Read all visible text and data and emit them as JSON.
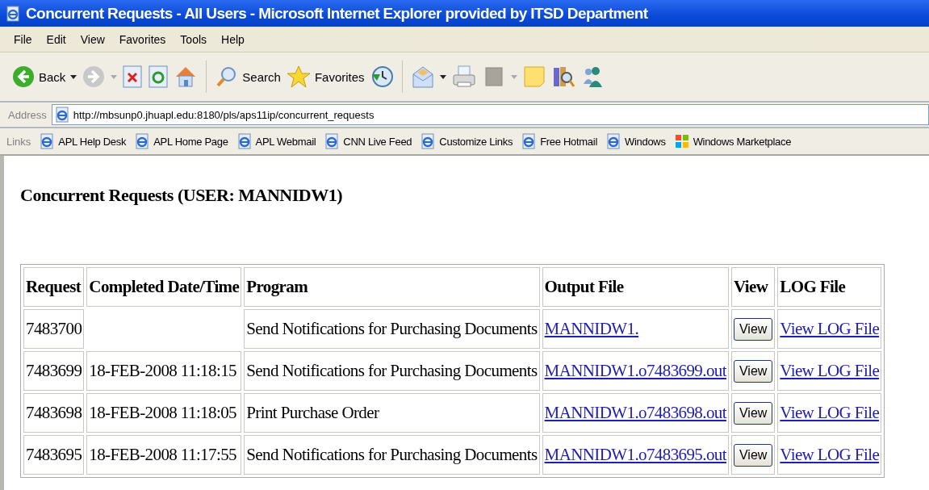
{
  "window": {
    "title": "Concurrent Requests - All Users - Microsoft Internet Explorer provided by ITSD Department"
  },
  "menu": [
    "File",
    "Edit",
    "View",
    "Favorites",
    "Tools",
    "Help"
  ],
  "toolbar": {
    "back_label": "Back",
    "search_label": "Search",
    "favorites_label": "Favorites"
  },
  "address": {
    "label": "Address",
    "value": "http://mbsunp0.jhuapl.edu:8180/pls/aps11ip/concurrent_requests"
  },
  "links": {
    "label": "Links",
    "items": [
      {
        "label": "APL Help Desk",
        "kind": "page"
      },
      {
        "label": "APL Home Page",
        "kind": "page"
      },
      {
        "label": "APL Webmail",
        "kind": "page"
      },
      {
        "label": "CNN Live Feed",
        "kind": "page"
      },
      {
        "label": "Customize Links",
        "kind": "page"
      },
      {
        "label": "Free Hotmail",
        "kind": "page"
      },
      {
        "label": "Windows",
        "kind": "page"
      },
      {
        "label": "Windows Marketplace",
        "kind": "flag"
      }
    ]
  },
  "page": {
    "heading": "Concurrent Requests (USER: MANNIDW1)"
  },
  "table": {
    "columns": [
      "Request",
      "Completed Date/Time",
      "Program",
      "Output File",
      "View",
      "LOG File"
    ],
    "rows": [
      {
        "request": "7483700",
        "program": "Send Notifications for Purchasing Documents",
        "output_file": "MANNIDW1.",
        "view_button": "View",
        "log_link": "View LOG File"
      },
      {
        "request": "7483699",
        "completed": "18-FEB-2008 11:18:15",
        "program": "Send Notifications for Purchasing Documents",
        "output_file": "MANNIDW1.o7483699.out",
        "view_button": "View",
        "log_link": "View LOG File"
      },
      {
        "request": "7483698",
        "completed": "18-FEB-2008 11:18:05",
        "program": "Print Purchase Order",
        "output_file": "MANNIDW1.o7483698.out",
        "view_button": "View",
        "log_link": "View LOG File"
      },
      {
        "request": "7483695",
        "completed": "18-FEB-2008 11:17:55",
        "program": "Send Notifications for Purchasing Documents",
        "output_file": "MANNIDW1.o7483695.out",
        "view_button": "View",
        "log_link": "View LOG File"
      }
    ]
  }
}
